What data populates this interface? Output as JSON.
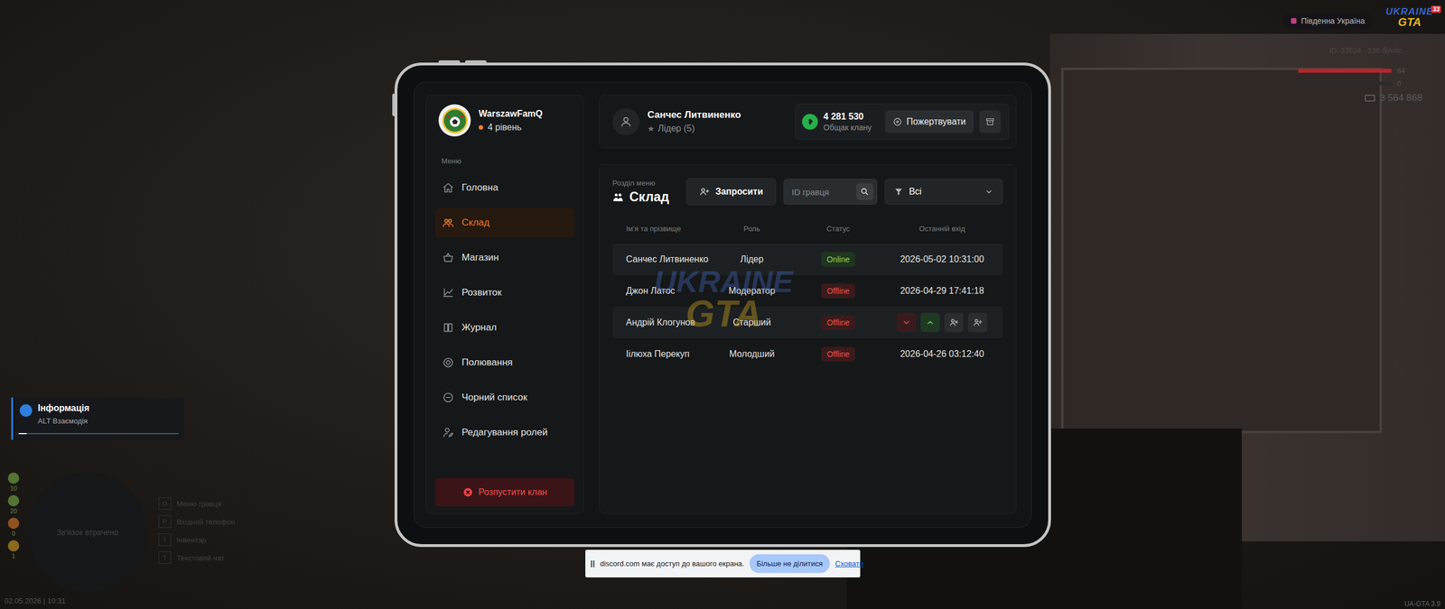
{
  "hud": {
    "server": "Південна Україна",
    "logo": {
      "top": "UKRAINE",
      "bottom": "GTA",
      "badge": "33"
    },
    "player_id": "ID: 33524",
    "extra": "236 білліс",
    "health": {
      "value": "64",
      "level": 1
    },
    "armor": {
      "value": "0",
      "level": 0
    },
    "money": "3 564 868",
    "notification": {
      "title": "Інформація",
      "text": "ALT Взаємодія",
      "level": 0.05
    },
    "minimap": {
      "text": "Зв'язок втрачено"
    },
    "status_icons": [
      {
        "color": "#7bb04a",
        "value": "10"
      },
      {
        "color": "#7bb04a",
        "value": "20"
      },
      {
        "color": "#e07b2a",
        "value": "0"
      },
      {
        "color": "#d9a421",
        "value": "1"
      }
    ],
    "hotkeys": [
      {
        "key": "O",
        "label": "Меню гравця"
      },
      {
        "key": "P",
        "label": "Вхідний телефон"
      },
      {
        "key": "I",
        "label": "Інвентар"
      },
      {
        "key": "T",
        "label": "Текстовий чат"
      }
    ],
    "datetime": "02.05.2026 | 10:31",
    "version": "UA-GTA 3.9"
  },
  "watermark": {
    "top": "UKRAINE",
    "bottom": "GTA"
  },
  "tablet": {
    "clan": {
      "name": "WarszawFamQ",
      "level": "4 рівень"
    },
    "menu_label": "Меню",
    "menu": [
      {
        "label": "Головна",
        "selected": false
      },
      {
        "label": "Склад",
        "selected": true
      },
      {
        "label": "Магазин",
        "selected": false
      },
      {
        "label": "Розвиток",
        "selected": false
      },
      {
        "label": "Журнал",
        "selected": false
      },
      {
        "label": "Полювання",
        "selected": false
      },
      {
        "label": "Чорний список",
        "selected": false
      },
      {
        "label": "Редагування ролей",
        "selected": false
      }
    ],
    "disband": "Розпустити клан",
    "user": {
      "name": "Санчес Литвиненко",
      "role": "Лідер (5)"
    },
    "balance": {
      "amount": "4 281 530",
      "label": "Общак клану"
    },
    "donate": "Пожертвувати",
    "section": {
      "caption": "Розділ меню",
      "title": "Склад"
    },
    "invite": "Запросити",
    "search": {
      "placeholder": "ID гравця"
    },
    "filter": {
      "value": "Всі"
    },
    "table": {
      "columns": [
        "Ім'я та прізвище",
        "Роль",
        "Статус",
        "Останній вхід"
      ],
      "row_actions": [
        {
          "kind": "demote"
        },
        {
          "kind": "promote"
        },
        {
          "kind": "kick"
        },
        {
          "kind": "add"
        }
      ],
      "rows": [
        {
          "name": "Санчес Литвиненко",
          "role": "Лідер",
          "status": "Online",
          "online": true,
          "last_login": "2026-05-02 10:31:00",
          "highlighted": true,
          "hovered": false
        },
        {
          "name": "Джон Латос",
          "role": "Модератор",
          "status": "Offline",
          "online": false,
          "last_login": "2026-04-29 17:41:18",
          "highlighted": false,
          "hovered": false
        },
        {
          "name": "Андрій Клогунов",
          "role": "Старший",
          "status": "Offline",
          "online": false,
          "highlighted": false,
          "hovered": true
        },
        {
          "name": "Іілюха Перекуп",
          "role": "Молодший",
          "status": "Offline",
          "online": false,
          "last_login": "2026-04-26 03:12:40",
          "highlighted": false,
          "hovered": false
        }
      ]
    }
  },
  "share_bar": {
    "text": "discord.com має доступ до вашого екрана.",
    "stop": "Більше не ділитися",
    "hide": "Сховати"
  }
}
